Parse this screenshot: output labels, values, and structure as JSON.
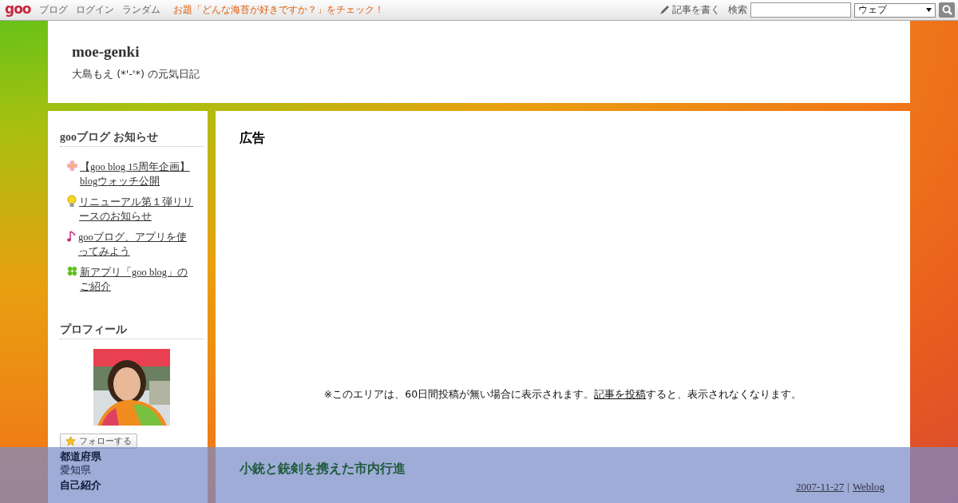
{
  "topbar": {
    "logo": "goo",
    "links": [
      "ブログ",
      "ログイン",
      "ランダム"
    ],
    "topic": "お題「どんな海苔が好きですか？」をチェック！",
    "write": "記事を書く",
    "search_label": "検索",
    "search_scope": "ウェブ"
  },
  "header": {
    "title": "moe-genki",
    "subtitle": "大島もえ (*'-'*) の元気日記"
  },
  "sidebar": {
    "news": {
      "title": "gooブログ お知らせ",
      "items": [
        {
          "kind": "flower",
          "text": "【goo blog 15周年企画】blogウォッチ公開"
        },
        {
          "kind": "bulb",
          "text": "リニューアル第１弾リリースのお知らせ"
        },
        {
          "kind": "note",
          "text": "gooブログ、アプリを使ってみよう"
        },
        {
          "kind": "clover",
          "text": "新アプリ「goo blog」のご紹介"
        }
      ]
    },
    "profile": {
      "title": "プロフィール",
      "follow": "フォローする",
      "fields": [
        {
          "label": "都道府県",
          "value": "愛知県"
        },
        {
          "label": "自己紹介"
        }
      ]
    }
  },
  "main": {
    "ad_title": "広告",
    "notice": {
      "before": "※このエリアは、60日間投稿が無い場合に表示されます。",
      "link": "記事を投稿",
      "after": "すると、表示されなくなります。"
    },
    "post": {
      "title": "小銃と銃剣を携えた市内行進",
      "date": "2007-11-27",
      "separator": "|",
      "category": "Weblog"
    }
  }
}
